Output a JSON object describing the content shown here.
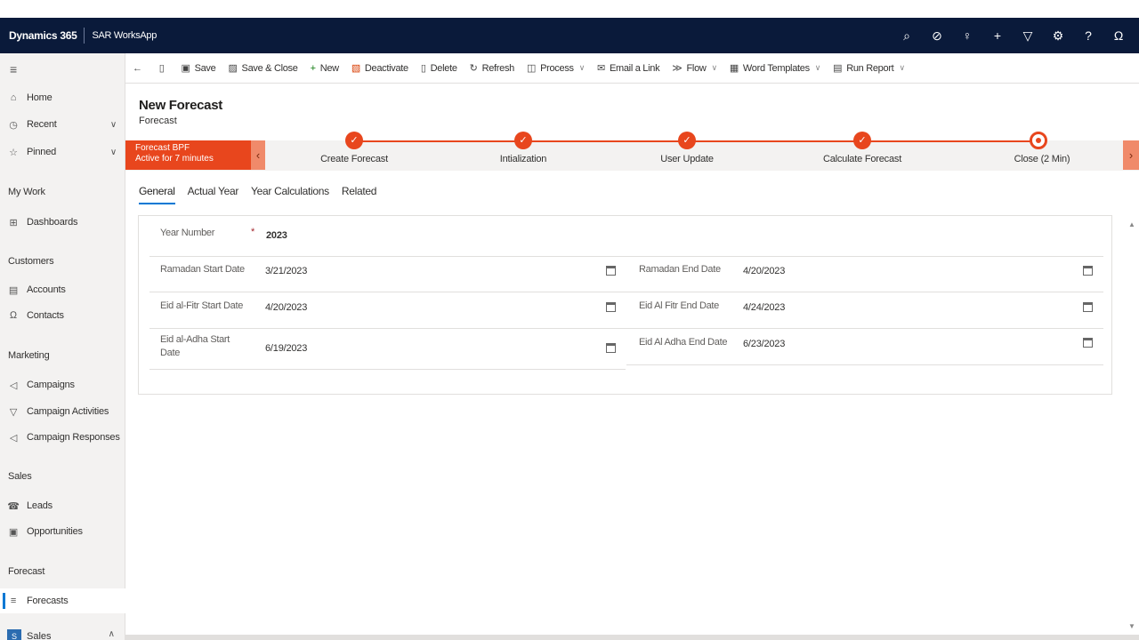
{
  "topbar": {
    "brand": "Dynamics 365",
    "app_name": "SAR WorksApp",
    "icons": [
      "search-icon",
      "task-icon",
      "lightbulb-icon",
      "plus-icon",
      "filter-icon",
      "settings-icon",
      "help-icon",
      "user-icon"
    ]
  },
  "sidebar": {
    "home": "Home",
    "recent": "Recent",
    "pinned": "Pinned",
    "groups": {
      "my_work": "My Work",
      "customers": "Customers",
      "marketing": "Marketing",
      "sales": "Sales",
      "forecast": "Forecast"
    },
    "items": {
      "dashboards": "Dashboards",
      "accounts": "Accounts",
      "contacts": "Contacts",
      "campaigns": "Campaigns",
      "campaign_activities": "Campaign Activities",
      "campaign_responses": "Campaign Responses",
      "leads": "Leads",
      "opportunities": "Opportunities",
      "forecasts": "Forecasts"
    },
    "area_badge": "S",
    "area_label": "Sales"
  },
  "commands": {
    "save": "Save",
    "save_close": "Save & Close",
    "new": "New",
    "deactivate": "Deactivate",
    "delete": "Delete",
    "refresh": "Refresh",
    "process": "Process",
    "email_link": "Email a Link",
    "flow": "Flow",
    "word_templates": "Word Templates",
    "run_report": "Run Report"
  },
  "form": {
    "title": "New Forecast",
    "entity": "Forecast"
  },
  "bpf": {
    "name": "Forecast BPF",
    "status": "Active for 7 minutes",
    "stages": [
      {
        "label": "Create Forecast",
        "state": "done"
      },
      {
        "label": "Intialization",
        "state": "done"
      },
      {
        "label": "User Update",
        "state": "done"
      },
      {
        "label": "Calculate Forecast",
        "state": "done"
      },
      {
        "label": "Close  (2 Min)",
        "state": "active"
      }
    ]
  },
  "tabs": [
    "General",
    "Actual Year",
    "Year Calculations",
    "Related"
  ],
  "fields": {
    "year_number": {
      "label": "Year Number",
      "value": "2023",
      "required": "*"
    },
    "ramadan_start": {
      "label": "Ramadan Start Date",
      "value": "3/21/2023"
    },
    "ramadan_end": {
      "label": "Ramadan End Date",
      "value": "4/20/2023"
    },
    "eid_fitr_start": {
      "label": "Eid al-Fitr Start Date",
      "value": "4/20/2023"
    },
    "eid_fitr_end": {
      "label": "Eid Al Fitr End Date",
      "value": "4/24/2023"
    },
    "eid_adha_start": {
      "label_line1": "Eid al-Adha Start",
      "label_line2": "Date",
      "value": "6/19/2023"
    },
    "eid_adha_end": {
      "label": "Eid Al Adha End Date",
      "value": "6/23/2023"
    }
  },
  "colors": {
    "topbar": "#0a1a3a",
    "bpf_accent": "#e8461d",
    "tab_underline": "#0078d4"
  }
}
